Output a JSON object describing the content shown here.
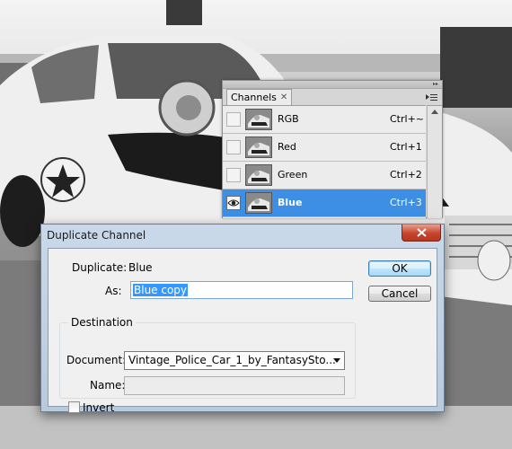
{
  "channels_panel": {
    "tab_label": "Channels",
    "channels": [
      {
        "name": "RGB",
        "shortcut": "Ctrl+~",
        "visible": false,
        "selected": false
      },
      {
        "name": "Red",
        "shortcut": "Ctrl+1",
        "visible": false,
        "selected": false
      },
      {
        "name": "Green",
        "shortcut": "Ctrl+2",
        "visible": false,
        "selected": false
      },
      {
        "name": "Blue",
        "shortcut": "Ctrl+3",
        "visible": true,
        "selected": true
      }
    ]
  },
  "dialog": {
    "title": "Duplicate Channel",
    "duplicate_label": "Duplicate:",
    "duplicate_value": "Blue",
    "as_label": "As:",
    "as_value": "Blue copy",
    "ok_label": "OK",
    "cancel_label": "Cancel",
    "destination_label": "Destination",
    "document_label": "Document:",
    "document_value": "Vintage_Police_Car_1_by_FantasySto...",
    "name_label": "Name:",
    "name_value": "",
    "invert_label": "Invert",
    "invert_checked": false
  },
  "colors": {
    "selection_blue": "#3d8ee5",
    "close_red": "#c7442c",
    "dialog_frame": "#c9d9ea"
  }
}
